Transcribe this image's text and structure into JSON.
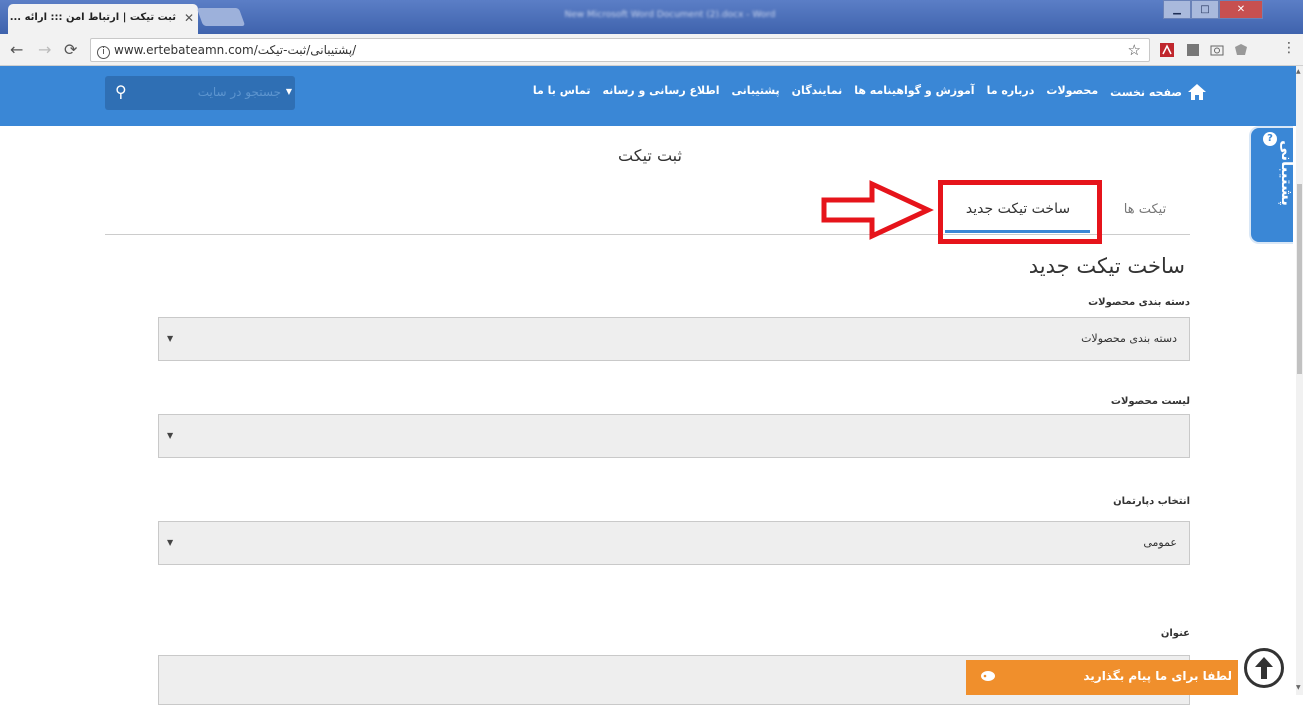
{
  "browser": {
    "tab_title": "ثبت تیکت | ارتباط امن ::: ارائه ...",
    "window_title": "New Microsoft Word Document (2).docx - Word",
    "url_domain": "www.ertebateamn.com",
    "url_path": "/پشتیبانی/ثبت-تیکت/",
    "close_symbol": "✕",
    "win_min": "▁",
    "win_max": "□",
    "win_close": "✕"
  },
  "nav": {
    "home": "صفحه نخست",
    "items": [
      "محصولات",
      "درباره ما",
      "آموزش و گواهینامه ها",
      "نمایندگان",
      "پشتیبانی",
      "اطلاع رسانی و رسانه",
      "تماس با ما"
    ],
    "search_placeholder": "جستجو در سایت"
  },
  "side_tab": {
    "label": "پشتیبانی"
  },
  "page": {
    "title": "ثبت تیکت",
    "tabs": {
      "new_ticket": "ساخت تیکت جدید",
      "tickets": "تیکت ها"
    },
    "form_heading": "ساخت تیکت جدید"
  },
  "form": {
    "category_label": "دسته بندی محصولات",
    "category_value": "دسته بندی محصولات",
    "products_label": "لیست محصولات",
    "products_value": "",
    "department_label": "انتخاب دپارتمان",
    "department_value": "عمومی",
    "subject_label": "عنوان"
  },
  "chat": {
    "label": "لطفا برای ما پیام بگذارید"
  },
  "colors": {
    "brand_blue": "#3a87d6",
    "highlight_red": "#e6141b",
    "chat_orange": "#f08f2c"
  }
}
